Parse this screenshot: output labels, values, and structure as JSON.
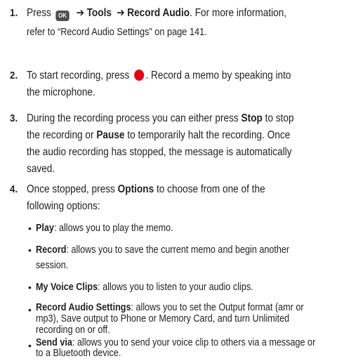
{
  "steps": [
    {
      "num": "1.",
      "parts": {
        "press": "Press",
        "ok_key": "OK",
        "arrow": "➔",
        "tools": "Tools",
        "record_audio": "Record Audio",
        "for_more": ". For more information,",
        "line2": "refer to “Record Audio Settings” on page 141."
      }
    },
    {
      "num": "2.",
      "parts": {
        "before_icon": "To start recording, press",
        "after_icon": ". Record a memo by speaking into",
        "line2": "the microphone."
      }
    },
    {
      "num": "3.",
      "parts": {
        "l1a": "During the recording process you can either press",
        "stop": "Stop",
        "l1b": "to stop",
        "l2a": "the recording or",
        "pause": "Pause",
        "l2b": "to temporarily halt the recording. Once",
        "line3": "the audio recording has stopped, the message is automatically",
        "line4": "saved."
      }
    },
    {
      "num": "4.",
      "parts": {
        "l1a": "Once stopped, press",
        "options": "Options",
        "l1b": "to choose from one of the",
        "line2": "following options:"
      }
    }
  ],
  "bullet_char": "•",
  "options_list": [
    {
      "term": "Play",
      "desc": ": allows you to play the memo.",
      "desc2": ""
    },
    {
      "term": "Record",
      "desc": ": allows you to save the current memo and begin another",
      "desc2": "session."
    },
    {
      "term": "My Voice Clips",
      "desc": ": allows you to listen to your audio clips.",
      "desc2": ""
    },
    {
      "term": "Record Audio Settings",
      "desc": ": allows you to set the Output format (amr or",
      "desc2": "mp3), Save output to Phone or Memory Card, and turn Unlimited",
      "desc3": "recording on or off."
    },
    {
      "term": "Send via",
      "desc": ": allows you to send your voice clip to others via a message or",
      "desc2": "to a Bluetooth device."
    }
  ],
  "colors": {
    "text": "#231f20",
    "ok_key_bg": "#4d4d4f",
    "record_dot": "#e3001b"
  }
}
